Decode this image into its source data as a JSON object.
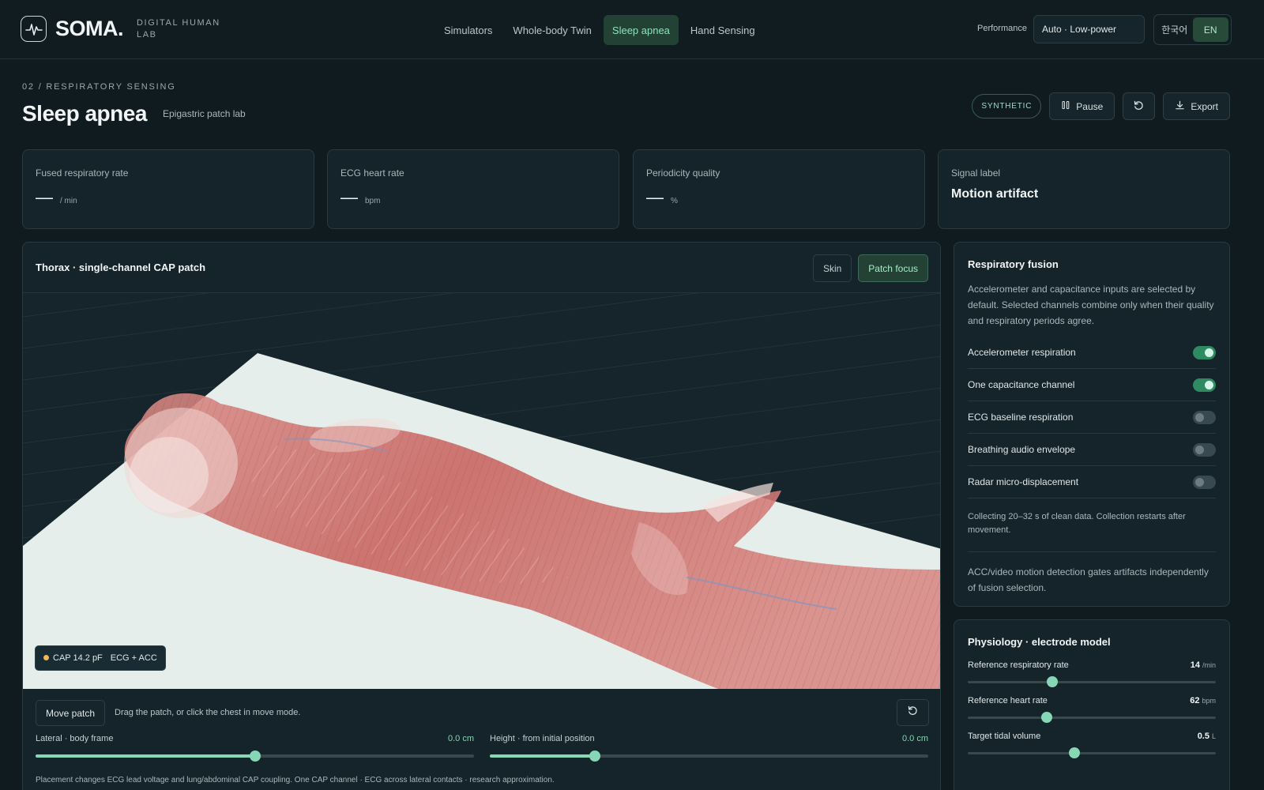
{
  "brand": {
    "name": "SOMA.",
    "subtitle": "DIGITAL HUMAN LAB"
  },
  "nav": {
    "items": [
      {
        "label": "Simulators"
      },
      {
        "label": "Whole-body Twin"
      },
      {
        "label": "Sleep apnea",
        "active": true
      },
      {
        "label": "Hand Sensing"
      }
    ]
  },
  "performance": {
    "label": "Performance",
    "value": "Auto · Low-power"
  },
  "language": {
    "ko": "한국어",
    "en": "EN",
    "selected": "EN"
  },
  "header": {
    "eyebrow": "02 / RESPIRATORY SENSING",
    "title": "Sleep apnea",
    "subtitle": "Epigastric patch lab",
    "badge": "SYNTHETIC",
    "pause_label": "Pause",
    "export_label": "Export"
  },
  "stats": [
    {
      "label": "Fused respiratory rate",
      "value": "—",
      "unit": "/ min"
    },
    {
      "label": "ECG heart rate",
      "value": "—",
      "unit": "bpm"
    },
    {
      "label": "Periodicity quality",
      "value": "—",
      "unit": "%"
    },
    {
      "label": "Signal label",
      "value": "Motion artifact"
    }
  ],
  "viewer": {
    "title": "Thorax · single-channel CAP patch",
    "view_skin": "Skin",
    "view_patch": "Patch focus",
    "active_view": "Patch focus",
    "badge_cap": "CAP 14.2 pF",
    "badge_mode": "ECG + ACC",
    "move_label": "Move patch",
    "move_hint": "Drag the patch, or click the chest in move mode.",
    "lateral": {
      "label": "Lateral · body frame",
      "value": "0.0 cm",
      "fraction": 0.5
    },
    "height": {
      "label": "Height · from initial position",
      "value": "0.0 cm",
      "fraction": 0.24
    },
    "footnote": "Placement changes ECG lead voltage and lung/abdominal CAP coupling. One CAP channel · ECG across lateral contacts · research approximation."
  },
  "fusion": {
    "title": "Respiratory fusion",
    "description": "Accelerometer and capacitance inputs are selected by default. Selected channels combine only when their quality and respiratory periods agree.",
    "toggles": [
      {
        "label": "Accelerometer respiration",
        "on": true
      },
      {
        "label": "One capacitance channel",
        "on": true
      },
      {
        "label": "ECG baseline respiration",
        "on": false
      },
      {
        "label": "Breathing audio envelope",
        "on": false
      },
      {
        "label": "Radar micro-displacement",
        "on": false
      }
    ],
    "note": "Collecting 20–32 s of clean data. Collection restarts after movement.",
    "note2": "ACC/video motion detection gates artifacts independently of fusion selection."
  },
  "physiology": {
    "title": "Physiology · electrode model",
    "params": [
      {
        "label": "Reference respiratory rate",
        "value": "14",
        "unit": "/min",
        "fraction": 0.34
      },
      {
        "label": "Reference heart rate",
        "value": "62",
        "unit": "bpm",
        "fraction": 0.32
      },
      {
        "label": "Target tidal volume",
        "value": "0.5",
        "unit": "L",
        "fraction": 0.43
      }
    ]
  }
}
